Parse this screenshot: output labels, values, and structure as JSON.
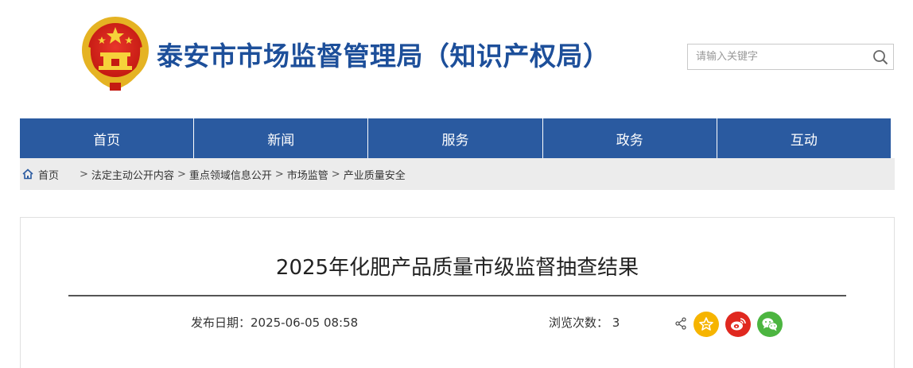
{
  "header": {
    "site_title": "泰安市市场监督管理局（知识产权局）",
    "search_placeholder": "请输入关键字"
  },
  "nav": {
    "items": [
      {
        "label": "首页"
      },
      {
        "label": "新闻"
      },
      {
        "label": "服务"
      },
      {
        "label": "政务"
      },
      {
        "label": "互动"
      }
    ]
  },
  "breadcrumb": {
    "home": "首页",
    "items": [
      "法定主动公开内容",
      "重点领域信息公开",
      "市场监管",
      "产业质量安全"
    ],
    "separator": ">"
  },
  "article": {
    "title": "2025年化肥产品质量市级监督抽查结果",
    "publish_date": "发布日期：2025-06-05 08:58",
    "view_count": "浏览次数： 3"
  },
  "colors": {
    "brand_blue": "#1d4f9a",
    "nav_blue": "#2a5aa0",
    "breadcrumb_bg": "#ececec",
    "fav_yellow": "#f6b400",
    "weibo_red": "#e0281f",
    "wechat_green": "#4cb540"
  },
  "icons": {
    "emblem": "national-emblem-icon",
    "search": "search-icon",
    "home": "home-icon",
    "share": "share-icon",
    "favorite": "star-icon",
    "weibo": "weibo-icon",
    "wechat": "wechat-icon"
  }
}
